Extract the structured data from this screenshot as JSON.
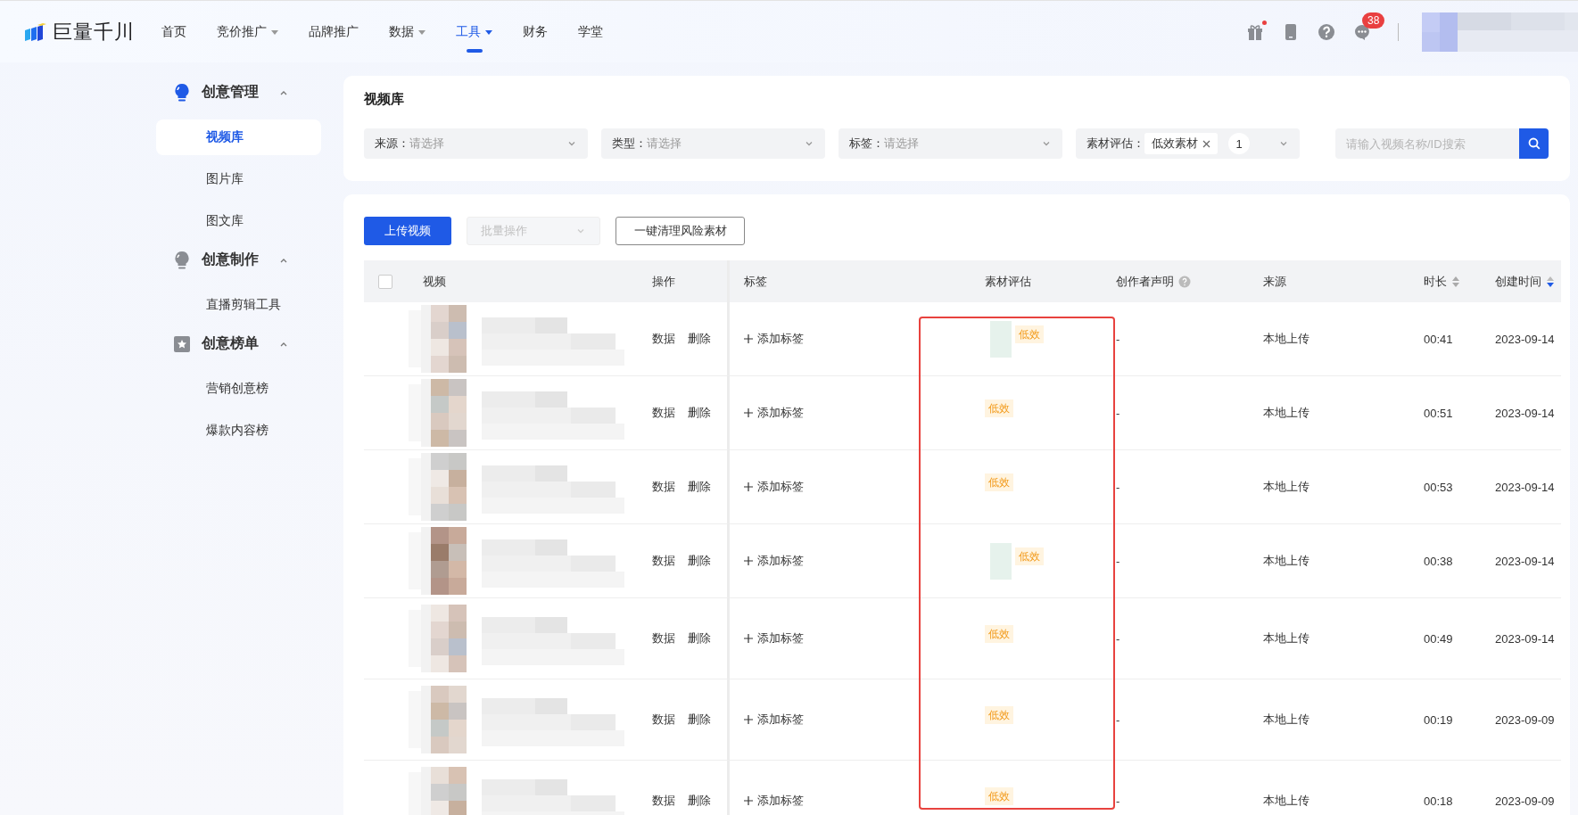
{
  "nav": {
    "logo_text": "巨量千川",
    "items": [
      {
        "label": "首页",
        "dropdown": false,
        "selected": false
      },
      {
        "label": "竞价推广",
        "dropdown": true,
        "selected": false
      },
      {
        "label": "品牌推广",
        "dropdown": false,
        "selected": false
      },
      {
        "label": "数据",
        "dropdown": true,
        "selected": false
      },
      {
        "label": "工具",
        "dropdown": true,
        "selected": true
      },
      {
        "label": "财务",
        "dropdown": false,
        "selected": false
      },
      {
        "label": "学堂",
        "dropdown": false,
        "selected": false
      }
    ],
    "actions": [
      {
        "kind": "gift",
        "dot": true
      },
      {
        "kind": "phone",
        "dot": false
      },
      {
        "kind": "help",
        "dot": false
      },
      {
        "kind": "message",
        "dot": false,
        "badge": "38"
      }
    ]
  },
  "sidebar": {
    "groups": [
      {
        "kind": "bulb",
        "title": "创意管理",
        "active": true,
        "expanded": true,
        "items": [
          {
            "label": "视频库",
            "selected": true
          },
          {
            "label": "图片库",
            "selected": false
          },
          {
            "label": "图文库",
            "selected": false
          }
        ]
      },
      {
        "kind": "bulb",
        "title": "创意制作",
        "active": false,
        "expanded": true,
        "items": [
          {
            "label": "直播剪辑工具",
            "selected": false
          }
        ]
      },
      {
        "kind": "star",
        "title": "创意榜单",
        "active": false,
        "expanded": true,
        "items": [
          {
            "label": "营销创意榜",
            "selected": false
          },
          {
            "label": "爆款内容榜",
            "selected": false
          }
        ]
      }
    ]
  },
  "filter_panel": {
    "title": "视频库",
    "filters": [
      {
        "kind": "select",
        "label": "来源：",
        "placeholder": "请选择"
      },
      {
        "kind": "select",
        "label": "类型：",
        "placeholder": "请选择"
      },
      {
        "kind": "select",
        "label": "标签：",
        "placeholder": "请选择"
      },
      {
        "kind": "tags",
        "label": "素材评估：",
        "tags": [
          "低效素材"
        ],
        "count": "1"
      }
    ],
    "search": {
      "placeholder": "请输入视频名称/ID搜索"
    }
  },
  "toolbar": {
    "buttons": [
      {
        "label": "上传视频",
        "kind": "primary",
        "disabled": false
      },
      {
        "label": "批量操作",
        "kind": "dropdown",
        "disabled": true
      },
      {
        "label": "一键清理风险素材",
        "kind": "default",
        "disabled": false
      }
    ]
  },
  "table": {
    "select_all": {
      "checked": false
    },
    "annotation": {
      "kind": "frame"
    },
    "columns": [
      {
        "label": "视频",
        "help": false,
        "sortable": false,
        "sorted_desc": false
      },
      {
        "label": "操作",
        "help": false,
        "sortable": false,
        "sorted_desc": false
      },
      {
        "label": "标签",
        "help": false,
        "sortable": false,
        "sorted_desc": false
      },
      {
        "label": "素材评估",
        "help": false,
        "sortable": false,
        "sorted_desc": false
      },
      {
        "label": "创作者声明",
        "help": true,
        "sortable": false,
        "sorted_desc": false
      },
      {
        "label": "来源",
        "help": false,
        "sortable": false,
        "sorted_desc": false
      },
      {
        "label": "时长",
        "help": false,
        "sortable": true,
        "sorted_desc": false
      },
      {
        "label": "创建时间",
        "help": false,
        "sortable": true,
        "sorted_desc": true
      }
    ],
    "rows": [
      {
        "actions": [
          "数据",
          "删除"
        ],
        "tag_action": "添加标签",
        "evaluation": {
          "label": "低效",
          "thumbnail": true
        },
        "creator_statement": "-",
        "source": "本地上传",
        "duration": "00:41",
        "created": "2023-09-14"
      },
      {
        "actions": [
          "数据",
          "删除"
        ],
        "tag_action": "添加标签",
        "evaluation": {
          "label": "低效",
          "thumbnail": false
        },
        "creator_statement": "-",
        "source": "本地上传",
        "duration": "00:51",
        "created": "2023-09-14"
      },
      {
        "actions": [
          "数据",
          "删除"
        ],
        "tag_action": "添加标签",
        "evaluation": {
          "label": "低效",
          "thumbnail": false
        },
        "creator_statement": "-",
        "source": "本地上传",
        "duration": "00:53",
        "created": "2023-09-14"
      },
      {
        "actions": [
          "数据",
          "删除"
        ],
        "tag_action": "添加标签",
        "evaluation": {
          "label": "低效",
          "thumbnail": true
        },
        "creator_statement": "-",
        "source": "本地上传",
        "duration": "00:38",
        "created": "2023-09-14"
      },
      {
        "actions": [
          "数据",
          "删除"
        ],
        "tag_action": "添加标签",
        "evaluation": {
          "label": "低效",
          "thumbnail": false
        },
        "creator_statement": "-",
        "source": "本地上传",
        "duration": "00:49",
        "created": "2023-09-14"
      },
      {
        "actions": [
          "数据",
          "删除"
        ],
        "tag_action": "添加标签",
        "evaluation": {
          "label": "低效",
          "thumbnail": false
        },
        "creator_statement": "-",
        "source": "本地上传",
        "duration": "00:19",
        "created": "2023-09-09"
      },
      {
        "actions": [
          "数据",
          "删除"
        ],
        "tag_action": "添加标签",
        "evaluation": {
          "label": "低效",
          "thumbnail": false
        },
        "creator_statement": "-",
        "source": "本地上传",
        "duration": "00:18",
        "created": "2023-09-09"
      }
    ]
  }
}
